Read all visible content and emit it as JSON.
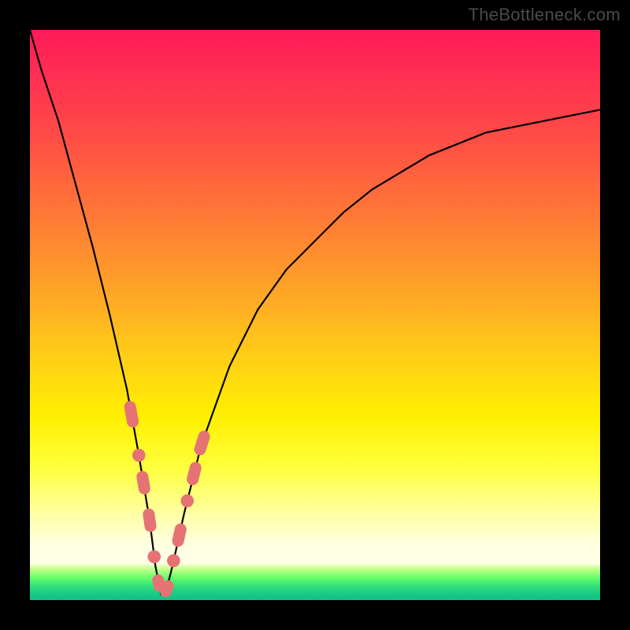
{
  "watermark": "TheBottleneck.com",
  "colors": {
    "marker": "#e57373",
    "curve": "#000000",
    "frame": "#000000"
  },
  "chart_data": {
    "type": "line",
    "title": "",
    "xlabel": "",
    "ylabel": "",
    "xlim": [
      0,
      100
    ],
    "ylim": [
      0,
      100
    ],
    "grid": false,
    "legend": false,
    "comment": "V-shaped bottleneck curve. Y values are approximate percent height of the curve read from the plot (0 = bottom of colored area, 100 = top). X is percent across the plot width. Minimum (~0) around x≈23.",
    "series": [
      {
        "name": "bottleneck-curve",
        "x": [
          0,
          2,
          5,
          8,
          11,
          14,
          17,
          19,
          21,
          22,
          23,
          24,
          25,
          27,
          30,
          35,
          40,
          45,
          50,
          55,
          60,
          65,
          70,
          75,
          80,
          85,
          90,
          95,
          100
        ],
        "values": [
          100,
          93,
          84,
          73,
          62,
          50,
          37,
          26,
          14,
          6,
          1,
          2,
          6,
          15,
          27,
          41,
          51,
          58,
          63,
          68,
          72,
          75,
          78,
          80,
          82,
          83,
          84,
          85,
          86
        ]
      }
    ],
    "markers": {
      "comment": "Pink rounded markers highlighting the region around the notch.",
      "left_strip": {
        "x_range": [
          17.5,
          21.5
        ],
        "y_range": [
          7,
          27
        ]
      },
      "right_strip": {
        "x_range": [
          25.0,
          30.0
        ],
        "y_range": [
          10,
          30
        ]
      },
      "bottom_strip": {
        "x_range": [
          21.5,
          25.0
        ],
        "y_range": [
          0,
          4
        ]
      }
    }
  }
}
